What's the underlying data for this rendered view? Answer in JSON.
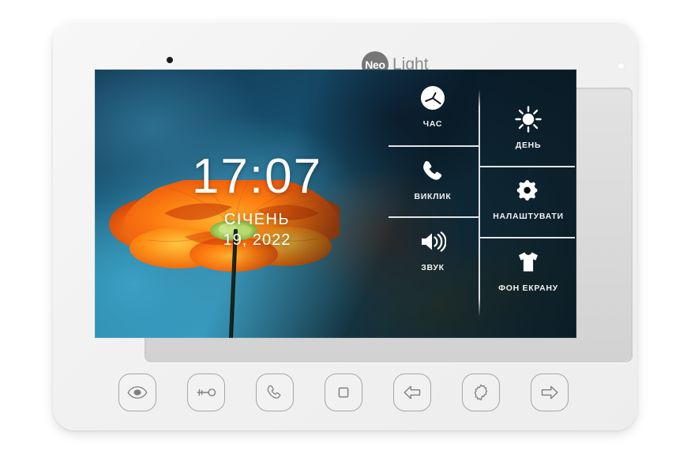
{
  "device": {
    "brand_badge": "Neo",
    "brand_word": "Light",
    "sensor_icon": "camera-sensor-dot",
    "led_icon": "status-led-dot"
  },
  "screen": {
    "time": "17:07",
    "month": "СІЧЕНЬ",
    "date": "19, 2022",
    "wallpaper": "orange-poppy-on-blue"
  },
  "menu": {
    "left_column": [
      {
        "id": "time",
        "label": "ЧАС",
        "icon": "clock-icon"
      },
      {
        "id": "call",
        "label": "ВИКЛИК",
        "icon": "phone-handset-icon"
      },
      {
        "id": "sound",
        "label": "ЗВУК",
        "icon": "speaker-volume-icon"
      }
    ],
    "right_column": [
      {
        "id": "day",
        "label": "ДЕНЬ",
        "icon": "sun-brightness-icon"
      },
      {
        "id": "settings",
        "label": "НАЛАШТУВАТИ",
        "icon": "gear-icon"
      },
      {
        "id": "wallpaper",
        "label": "ФОН ЕКРАНУ",
        "icon": "tshirt-icon"
      }
    ]
  },
  "hardware_buttons": [
    {
      "id": "monitor",
      "icon": "eye-icon"
    },
    {
      "id": "unlock",
      "icon": "key-icon"
    },
    {
      "id": "talk",
      "icon": "phone-handset-icon"
    },
    {
      "id": "stop",
      "icon": "square-stop-icon"
    },
    {
      "id": "previous",
      "icon": "arrow-left-icon"
    },
    {
      "id": "settings",
      "icon": "gear-sunburst-icon"
    },
    {
      "id": "next",
      "icon": "arrow-right-icon"
    }
  ],
  "colors": {
    "body": "#f2f2f2",
    "logo_gray": "#8a8a8a",
    "button_outline": "#a6a6a6",
    "screen_text": "#ffffff",
    "wallpaper_blue": "#2d83a6",
    "flower_orange": "#f4610c"
  }
}
